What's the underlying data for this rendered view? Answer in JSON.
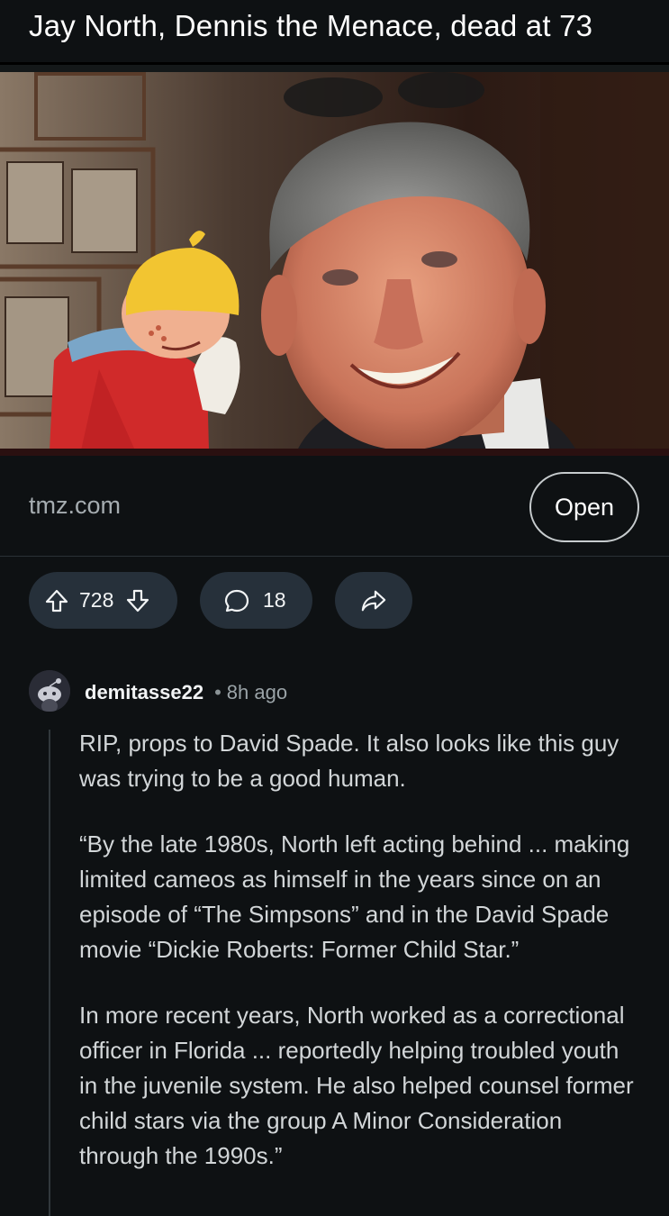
{
  "post": {
    "title": "Jay North, Dennis the Menace, dead at 73",
    "link_domain": "tmz.com",
    "open_label": "Open"
  },
  "actions": {
    "upvote_icon": "arrow-up-icon",
    "downvote_icon": "arrow-down-icon",
    "score": "728",
    "comment_icon": "speech-bubble-icon",
    "comment_count": "18",
    "share_icon": "share-arrow-icon"
  },
  "comment": {
    "author": "demitasse22",
    "separator": "•",
    "age": "8h ago",
    "paragraphs": [
      "RIP, props to David Spade. It also looks like this guy was trying to be a good human.",
      "“By the late 1980s, North left acting behind ... making limited cameos as himself in the years since on an episode of “The Simpsons” and in the David Spade movie “Dickie Roberts: Former Child Star.”",
      "In more recent years, North worked as a correctional officer in Florida ... reportedly helping troubled youth in the juvenile system. He also helped counsel former child stars via the group A Minor Consideration through the 1990s.”"
    ]
  },
  "colors": {
    "background": "#0e1113",
    "pill": "#26303a",
    "text": "#d2d6d8"
  }
}
